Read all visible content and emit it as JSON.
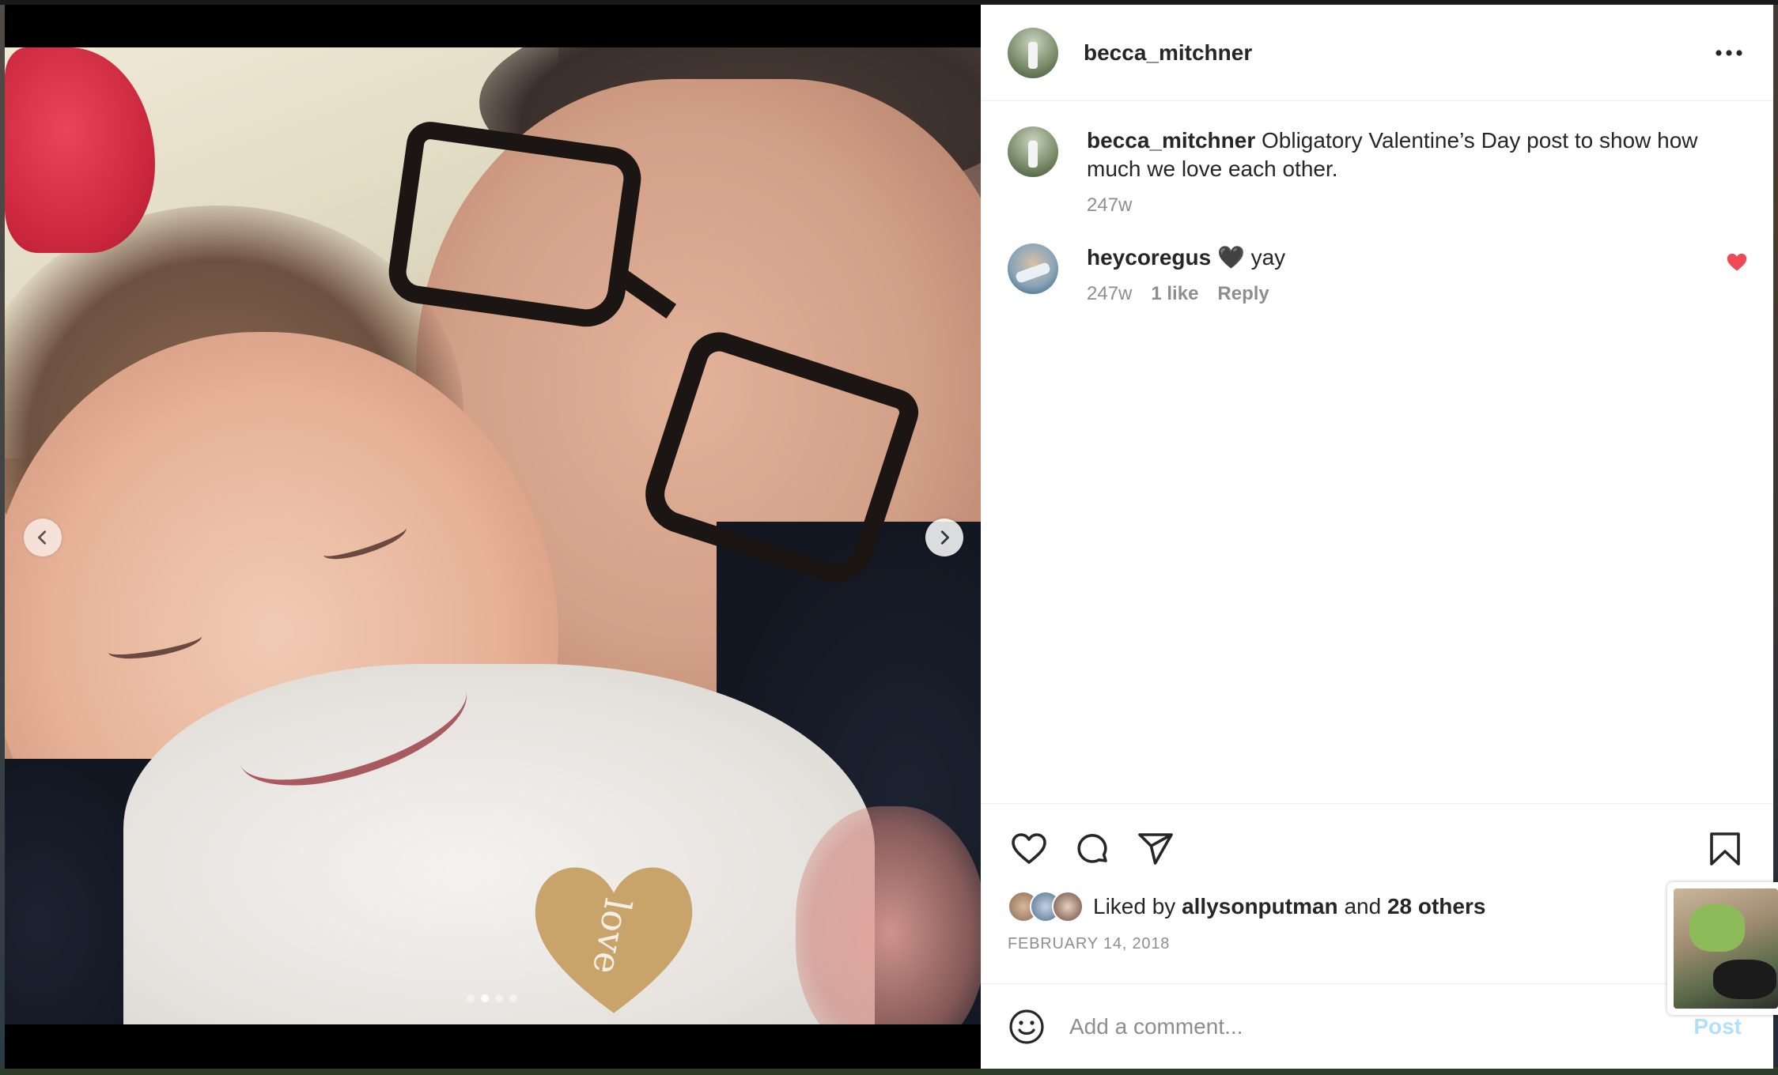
{
  "post": {
    "username": "becca_mitchner",
    "caption_username": "becca_mitchner",
    "caption": "Obligatory Valentine’s Day post to show how much we love each other.",
    "caption_age": "247w",
    "media_slides": 4,
    "active_slide": 2
  },
  "comments": [
    {
      "username": "heycoregus",
      "text": "🖤 yay",
      "age": "247w",
      "likes": "1 like",
      "reply_label": "Reply",
      "liked": true
    }
  ],
  "likes": {
    "prefix": "Liked by",
    "first_user": "allysonputman",
    "joiner": "and",
    "others": "28 others"
  },
  "date": "FEBRUARY 14, 2018",
  "add_comment": {
    "placeholder": "Add a comment...",
    "post_label": "Post"
  },
  "icons": {
    "more": "more-horizontal-icon",
    "like": "heart-outline-icon",
    "comment": "comment-bubble-icon",
    "share": "paper-plane-icon",
    "save": "bookmark-icon",
    "emoji": "smiley-icon",
    "prev": "chevron-left-icon",
    "next": "chevron-right-icon",
    "liked_comment": "heart-filled-icon"
  },
  "colors": {
    "liked_heart": "#ed4956",
    "post_disabled": "#b2dffc",
    "secondary_text": "#8e8e8e"
  }
}
